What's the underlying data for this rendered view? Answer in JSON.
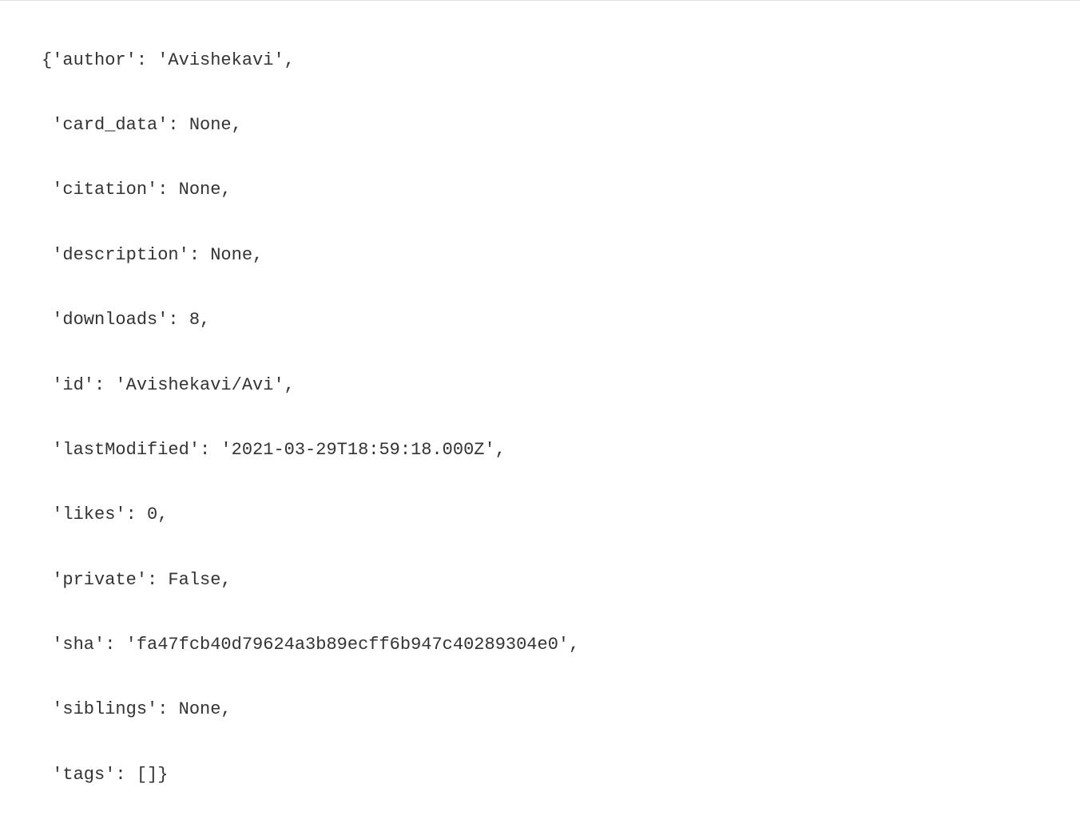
{
  "code": {
    "line1": "{'author': 'Avishekavi',",
    "line2": " 'card_data': None,",
    "line3": " 'citation': None,",
    "line4": " 'description': None,",
    "line5": " 'downloads': 8,",
    "line6": " 'id': 'Avishekavi/Avi',",
    "line7": " 'lastModified': '2021-03-29T18:59:18.000Z',",
    "line8": " 'likes': 0,",
    "line9": " 'private': False,",
    "line10": " 'sha': 'fa47fcb40d79624a3b89ecff6b947c40289304e0',",
    "line11": " 'siblings': None,",
    "line12": " 'tags': []}"
  }
}
